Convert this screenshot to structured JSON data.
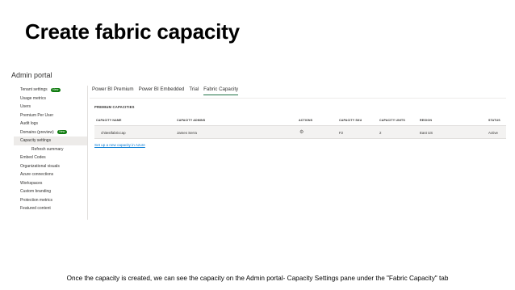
{
  "slide": {
    "title": "Create fabric capacity",
    "caption": "Once the capacity is created, we can see the capacity on the Admin portal- Capacity Settings pane under the \"Fabric Capacity\" tab"
  },
  "portal": {
    "title": "Admin portal",
    "sidebar": {
      "items": [
        {
          "label": "Tenant settings",
          "badge": "New"
        },
        {
          "label": "Usage metrics"
        },
        {
          "label": "Users"
        },
        {
          "label": "Premium Per User"
        },
        {
          "label": "Audit logs"
        },
        {
          "label": "Domains (preview)",
          "badge": "New"
        },
        {
          "label": "Capacity settings",
          "active": true
        },
        {
          "label": "Refresh summary",
          "sub": true
        },
        {
          "label": "Embed Codes"
        },
        {
          "label": "Organizational visuals"
        },
        {
          "label": "Azure connections"
        },
        {
          "label": "Workspaces"
        },
        {
          "label": "Custom branding"
        },
        {
          "label": "Protection metrics"
        },
        {
          "label": "Featured content"
        }
      ]
    },
    "tabs": [
      "Power BI Premium",
      "Power BI Embedded",
      "Trial",
      "Fabric Capacity"
    ],
    "active_tab": "Fabric Capacity",
    "section_title": "PREMIUM CAPACITIES",
    "table": {
      "columns": [
        "CAPACITY NAME",
        "CAPACITY ADMINS",
        "ACTIONS",
        "CAPACITY SKU",
        "CAPACITY UNITS",
        "REGION",
        "STATUS"
      ],
      "rows": [
        {
          "name": "chitestfabriccap",
          "admins": "James Serra",
          "actions_icon": "gear-icon",
          "sku": "F2",
          "units": "2",
          "region": "East US",
          "status": "Active"
        }
      ]
    },
    "setup_link": "Set up a new capacity in Azure",
    "colors": {
      "accent": "#217346",
      "link": "#0078d4",
      "badge": "#107c10"
    }
  }
}
